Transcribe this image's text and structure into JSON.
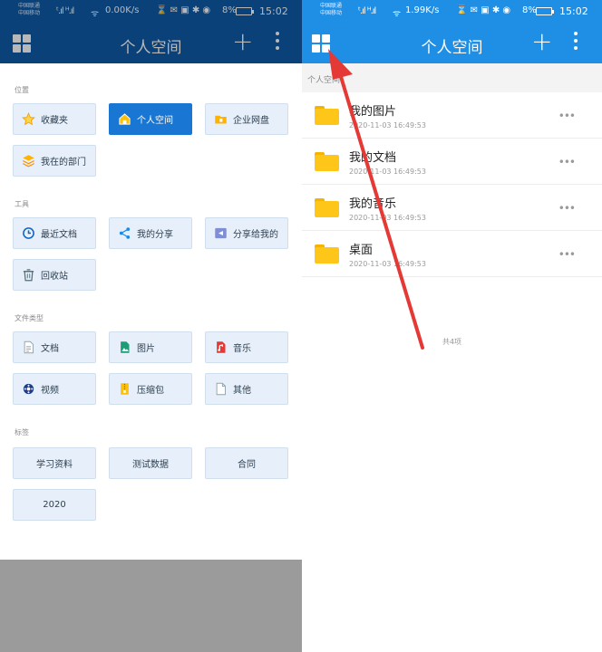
{
  "left_screen": {
    "status": {
      "carrier1": "中国联通",
      "carrier2": "中国移动",
      "speed": "0.00K/s",
      "battery": "8%",
      "time": "15:02"
    },
    "appbar": {
      "title": "个人空间",
      "add_icon": "plus-icon",
      "more_icon": "more-vert-icon",
      "menu_icon": "grid-icon"
    },
    "sections": {
      "location": {
        "label": "位置",
        "items": [
          {
            "label": "收藏夹",
            "icon": "star-icon"
          },
          {
            "label": "个人空间",
            "icon": "home-folder-icon",
            "active": true
          },
          {
            "label": "企业网盘",
            "icon": "enterprise-folder-icon"
          },
          {
            "label": "我在的部门",
            "icon": "department-icon"
          }
        ]
      },
      "tools": {
        "label": "工具",
        "items": [
          {
            "label": "最近文档",
            "icon": "clock-icon"
          },
          {
            "label": "我的分享",
            "icon": "share-icon"
          },
          {
            "label": "分享给我的",
            "icon": "shared-with-me-icon"
          },
          {
            "label": "回收站",
            "icon": "trash-icon"
          }
        ]
      },
      "filetypes": {
        "label": "文件类型",
        "items": [
          {
            "label": "文档",
            "icon": "document-icon"
          },
          {
            "label": "图片",
            "icon": "image-icon"
          },
          {
            "label": "音乐",
            "icon": "music-icon"
          },
          {
            "label": "视频",
            "icon": "video-icon"
          },
          {
            "label": "压缩包",
            "icon": "archive-icon"
          },
          {
            "label": "其他",
            "icon": "other-file-icon"
          }
        ]
      },
      "tags": {
        "label": "标签",
        "items": [
          {
            "label": "学习资料"
          },
          {
            "label": "测试数据"
          },
          {
            "label": "合同"
          },
          {
            "label": "2020"
          }
        ]
      }
    }
  },
  "right_screen": {
    "status": {
      "carrier1": "中国联通",
      "carrier2": "中国移动",
      "speed": "1.99K/s",
      "battery": "8%",
      "time": "15:02"
    },
    "appbar": {
      "title": "个人空间",
      "add_icon": "plus-icon",
      "more_icon": "more-vert-icon",
      "menu_icon": "grid-icon"
    },
    "path": "个人空间",
    "files": [
      {
        "name": "我的图片",
        "date": "2020-11-03 16:49:53"
      },
      {
        "name": "我的文档",
        "date": "2020-11-03 16:49:53"
      },
      {
        "name": "我的音乐",
        "date": "2020-11-03 16:49:53"
      },
      {
        "name": "桌面",
        "date": "2020-11-03 16:49:53"
      }
    ],
    "total": "共4项"
  },
  "colors": {
    "left_bar": "#0e5aa8",
    "right_bar": "#1f8fe5",
    "active_tile": "#1976d2",
    "folder": "#ffc61a",
    "arrow": "#e53935"
  }
}
